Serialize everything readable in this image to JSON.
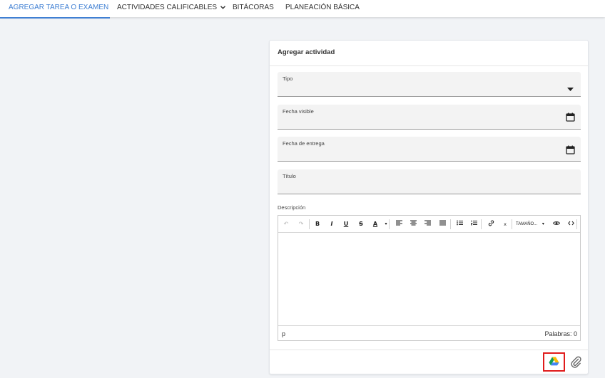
{
  "nav": {
    "tabs": [
      {
        "label": "AGREGAR TAREA O EXAMEN",
        "active": true
      },
      {
        "label": "ACTIVIDADES CALIFICABLES",
        "active": false,
        "has_dropdown": true
      },
      {
        "label": "BITÁCORAS",
        "active": false
      },
      {
        "label": "PLANEACIÓN BÁSICA",
        "active": false
      }
    ],
    "accent_color": "#3f7fd3"
  },
  "form": {
    "title": "Agregar actividad",
    "fields": [
      {
        "label": "Tipo",
        "value": "",
        "icon": "caret-down-icon"
      },
      {
        "label": "Fecha visible",
        "value": "",
        "icon": "calendar-icon"
      },
      {
        "label": "Fecha de entrega",
        "value": "",
        "icon": "calendar-icon"
      },
      {
        "label": "Título",
        "value": ""
      }
    ],
    "description_label": "Descripción",
    "editor": {
      "toolbar": {
        "undo": "↶",
        "redo": "↷",
        "bold": "B",
        "italic": "I",
        "underline": "U",
        "strike": "S",
        "font_color": "A",
        "font_size": "TAMAÑO...",
        "superscript": "x"
      },
      "content": "",
      "status_path": "p",
      "word_count": "Palabras: 0"
    },
    "attach_icons": [
      "google-drive-icon",
      "paperclip-icon"
    ],
    "highlight_color": "#e01b1b"
  }
}
